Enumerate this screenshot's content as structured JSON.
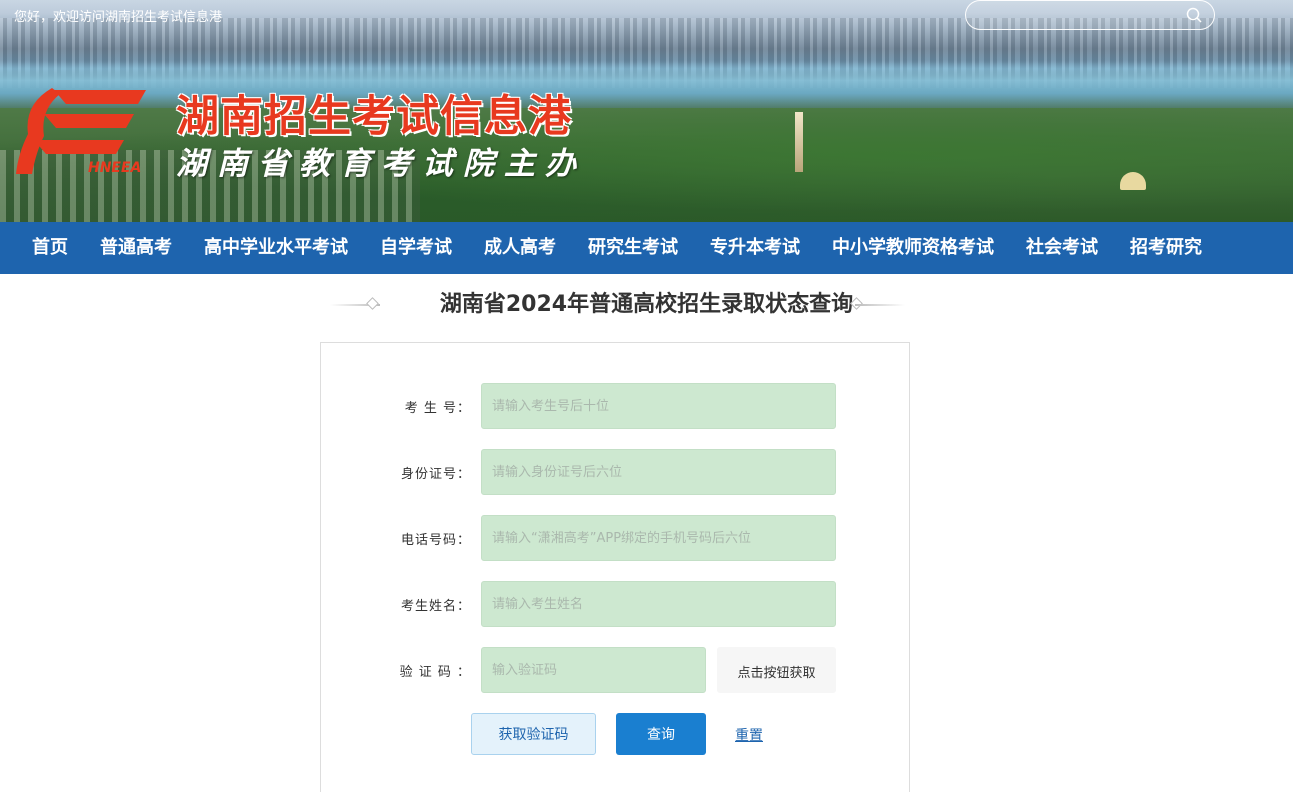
{
  "header": {
    "welcome": "您好，欢迎访问湖南招生考试信息港",
    "search_placeholder": "",
    "site_title": "湖南招生考试信息港",
    "site_subtitle": "湖南省教育考试院主办",
    "logo_text": "HNEEA",
    "brand_color": "#e8391f",
    "search_icon": "search-icon"
  },
  "nav": {
    "items": [
      {
        "label": "首页"
      },
      {
        "label": "普通高考"
      },
      {
        "label": "高中学业水平考试"
      },
      {
        "label": "自学考试"
      },
      {
        "label": "成人高考"
      },
      {
        "label": "研究生考试"
      },
      {
        "label": "专升本考试"
      },
      {
        "label": "中小学教师资格考试"
      },
      {
        "label": "社会考试"
      },
      {
        "label": "招考研究"
      }
    ],
    "background": "#1e64ae"
  },
  "main": {
    "page_title": "湖南省2024年普通高校招生录取状态查询"
  },
  "form": {
    "fields": [
      {
        "label": "考 生 号：",
        "placeholder": "请输入考生号后十位",
        "value": ""
      },
      {
        "label": "身份证号：",
        "placeholder": "请输入身份证号后六位",
        "value": ""
      },
      {
        "label": "电话号码：",
        "placeholder": "请输入“潇湘高考”APP绑定的手机号码后六位",
        "value": ""
      },
      {
        "label": "考生姓名：",
        "placeholder": "请输入考生姓名",
        "value": ""
      },
      {
        "label": "验 证 码 ：",
        "placeholder": "输入验证码",
        "value": ""
      }
    ],
    "captcha_button": "点击按钮获取",
    "get_code_button": "获取验证码",
    "query_button": "查询",
    "reset_link": "重置",
    "field_background": "#cde8d0",
    "accent": "#1a7fd0"
  }
}
